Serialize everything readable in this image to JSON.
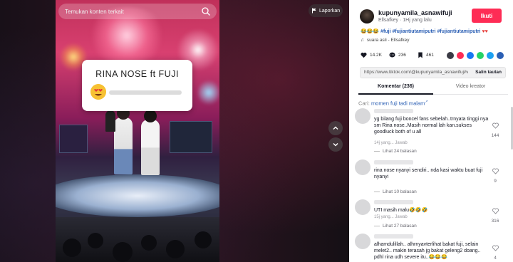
{
  "video": {
    "search_placeholder": "Temukan konten terkait",
    "report_label": "Laporkan",
    "card_title": "RINA NOSE ft FUJI"
  },
  "profile": {
    "username": "kupunyamila_asnawifuji",
    "nickname": "Ellsafkey",
    "time_ago": "1Hj yang lalu",
    "follow_label": "Ikuti"
  },
  "post": {
    "caption_emojis": "😂😂😂",
    "hashtags": "#fuji #fujiantiutamiputri #fujiantiutamiputri",
    "sound": "suara asli - Ellsafkey",
    "likes": "14.2K",
    "comments": "236",
    "saves": "461",
    "link": "https://www.tiktok.com/@kupunyamila_asnawifuji/v...",
    "copy_label": "Salin tautan"
  },
  "tabs": [
    {
      "label": "Komentar (236)",
      "active": true
    },
    {
      "label": "Video kreator",
      "active": false
    }
  ],
  "suggestion": {
    "prefix": "Cari:",
    "query": "momen fuji tadi malam"
  },
  "comments": [
    {
      "text": "yg bilang fuji boncel fans sebelah..trnyata tinggi nya sm Rina nose..Masih normal lah kan.sukses goodluck both of u all",
      "meta": "14j yang... Jawab",
      "replies": "Lihat 24 balasan",
      "likes": "144"
    },
    {
      "text": "rina nose nyanyi sendiri.. nda kasi waktu buat fuji nyanyi",
      "meta": "",
      "replies": "Lihat 10 balasan",
      "likes": "9"
    },
    {
      "text": "UTI masih malu🤣🤣🤣",
      "meta": "15j yang... Jawab",
      "replies": "Lihat 27 balasan",
      "likes": "316"
    },
    {
      "text": "alhamdulillah.. alhrnyavterlihat bakat fuji, selain melet2.. makin terasah jg bakat geleng2 doang.. pdhl rina udh severe itu..😂😂😂",
      "meta": "",
      "replies": "",
      "likes": "4"
    }
  ],
  "colors": {
    "accent": "#fe2c55",
    "link": "#2b5fb4"
  }
}
